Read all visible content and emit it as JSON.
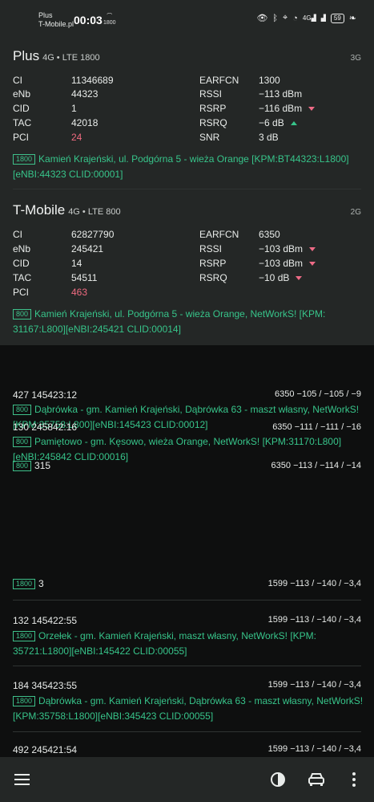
{
  "status": {
    "carrier1": "Plus",
    "carrier2": "T-Mobile.pl",
    "time": "00:03",
    "small_band": "1800",
    "net_label": "4G",
    "battery": "59"
  },
  "plus": {
    "name": "Plus",
    "tech": "4G • LTE 1800",
    "alt": "3G",
    "ci_label": "CI",
    "ci": "11346689",
    "enb_label": "eNb",
    "enb": "44323",
    "cid_label": "CID",
    "cid": "1",
    "tac_label": "TAC",
    "tac": "42018",
    "pci_label": "PCI",
    "pci": "24",
    "earfcn_label": "EARFCN",
    "earfcn": "1300",
    "rssi_label": "RSSI",
    "rssi": "−113 dBm",
    "rsrp_label": "RSRP",
    "rsrp": "−116 dBm",
    "rsrq_label": "RSRQ",
    "rsrq": "−6 dB",
    "snr_label": "SNR",
    "snr": "3 dB",
    "badge": "1800",
    "location_1": "Kamień Krajeński, ul. Podgórna 5 - wieża Orange [KPM:BT44323:L1800]",
    "location_2": "[eNBI:44323 CLID:00001]"
  },
  "tmobile": {
    "name": "T-Mobile",
    "tech": "4G • LTE 800",
    "alt": "2G",
    "ci_label": "CI",
    "ci": "62827790",
    "enb_label": "eNb",
    "enb": "245421",
    "cid_label": "CID",
    "cid": "14",
    "tac_label": "TAC",
    "tac": "54511",
    "pci_label": "PCI",
    "pci": "463",
    "earfcn_label": "EARFCN",
    "earfcn": "6350",
    "rssi_label": "RSSI",
    "rssi": "−103 dBm",
    "rsrp_label": "RSRP",
    "rsrp": "−103 dBm",
    "rsrq_label": "RSRQ",
    "rsrq": "−10 dB",
    "badge": "800",
    "location_1": "Kamień Krajeński, ul. Podgórna 5 - wieża Orange, NetWorkS! [KPM:",
    "location_2": "31167:L800][eNBI:245421 CLID:00014]"
  },
  "list": {
    "r1_id": "427  145423:12",
    "r1_meta": "6350  −105 / −105 / −9",
    "r1_badge": "800",
    "r1_loc1": "Dąbrówka - gm. Kamień Krajeński, Dąbrówka 63 - maszt własny, NetWorkS!",
    "r1_loc2": "[KPM:35758:L800][eNBI:145423 CLID:00012]",
    "r2_id": "130  245842:16",
    "r2_meta": "6350  −111 / −111 / −16",
    "r2_badge": "800",
    "r2_loc1": "Pamiętowo - gm. Kęsowo, wieża Orange, NetWorkS! [KPM:31170:L800]",
    "r2_loc2": "[eNBI:245842 CLID:00016]",
    "r3_badge": "800",
    "r3_id": "315",
    "r3_meta": "6350  −113 / −114 / −14",
    "r4_badge": "1800",
    "r4_id": "3",
    "r4_meta": "1599  −113 / −140 / −3,4",
    "r5_id": "132  145422:55",
    "r5_meta": "1599  −113 / −140 / −3,4",
    "r5_badge": "1800",
    "r5_loc1": "Orzełek - gm. Kamień Krajeński, maszt własny, NetWorkS! [KPM:",
    "r5_loc2": "35721:L1800][eNBI:145422 CLID:00055]",
    "r6_id": "184  345423:55",
    "r6_meta": "1599  −113 / −140 / −3,4",
    "r6_badge": "1800",
    "r6_loc1": "Dąbrówka - gm. Kamień Krajeński, Dąbrówka 63 - maszt własny, NetWorkS!",
    "r6_loc2": "[KPM:35758:L1800][eNBI:345423 CLID:00055]",
    "r7_id": "492  245421:54",
    "r7_meta": "1599  −113 / −140 / −3,4"
  },
  "colors": {
    "accent_green": "#37c48a",
    "warn_red": "#f06b80",
    "card_bg": "#242726",
    "page_bg": "#0e0f0f"
  },
  "icons": [
    "eye-icon",
    "bluetooth-icon",
    "location-icon",
    "signal-icon",
    "battery-icon",
    "menu-icon",
    "contrast-icon",
    "car-icon",
    "more-vert-icon"
  ]
}
